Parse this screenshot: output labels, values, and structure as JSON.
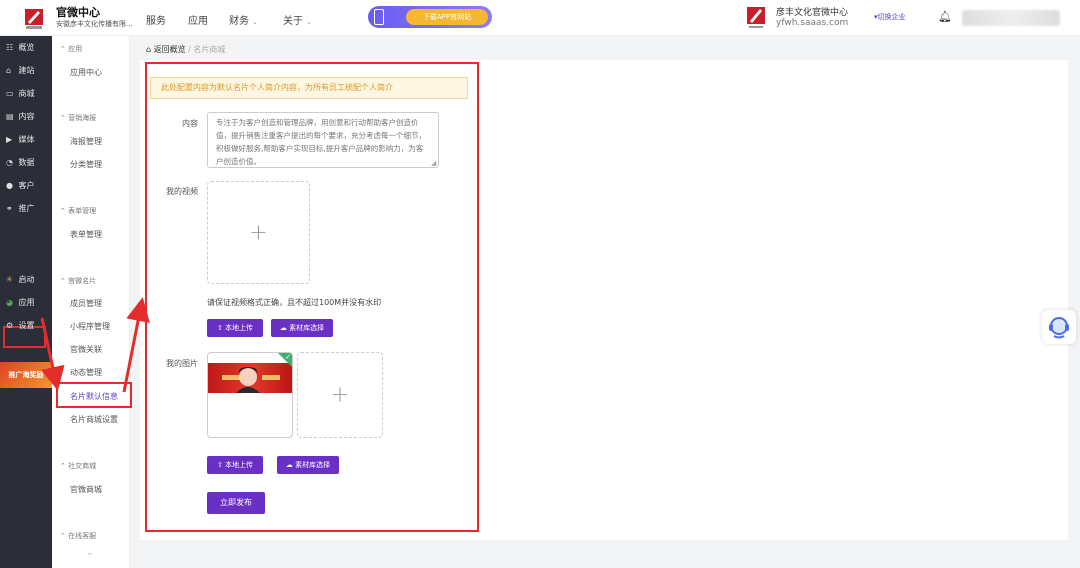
{
  "header": {
    "brand_title": "官微中心",
    "brand_sub": "安徽彦丰文化传播有限...",
    "nav": [
      {
        "label": "服务",
        "caret": false
      },
      {
        "label": "应用",
        "caret": false
      },
      {
        "label": "财务",
        "caret": true
      },
      {
        "label": "关于",
        "caret": true
      }
    ],
    "download_label": "下载APP官网站",
    "company_name": "彦丰文化官微中心",
    "company_url": "yfwh.saaas.com",
    "switch_label": "切换企业"
  },
  "sidebar": {
    "items": [
      {
        "icon": "overview-icon",
        "glyph": "☷",
        "label": "概览"
      },
      {
        "icon": "home-icon",
        "glyph": "⌂",
        "label": "建站"
      },
      {
        "icon": "shop-icon",
        "glyph": "▭",
        "label": "商城"
      },
      {
        "icon": "content-icon",
        "glyph": "▤",
        "label": "内容"
      },
      {
        "icon": "media-icon",
        "glyph": "▶",
        "label": "媒体"
      },
      {
        "icon": "data-icon",
        "glyph": "◔",
        "label": "数据"
      },
      {
        "icon": "customer-icon",
        "glyph": "●",
        "label": "客户"
      },
      {
        "icon": "promote-icon",
        "glyph": "⚭",
        "label": "推广"
      }
    ],
    "launch": "启动",
    "app": "应用",
    "settings": "设置",
    "promo": "推广海奖励"
  },
  "subnav": {
    "groups": [
      {
        "head": "应用",
        "items": [
          "应用中心"
        ]
      },
      {
        "head": "营销海报",
        "items": [
          "海报管理",
          "分类管理"
        ]
      },
      {
        "head": "表单管理",
        "items": [
          "表单管理"
        ]
      },
      {
        "head": "官微名片",
        "items": [
          "成员管理",
          "小程序管理",
          "官微关联",
          "动态管理",
          "名片默认信息",
          "名片商城设置"
        ]
      },
      {
        "head": "社交商城",
        "items": [
          "官微商城"
        ]
      },
      {
        "head": "在线客服",
        "items": []
      }
    ],
    "active": "名片默认信息"
  },
  "breadcrumb": {
    "home": "返回概览",
    "sep": "/",
    "current": "名片商城"
  },
  "form": {
    "notice": "此处配置内容为默认名片个人简介内容，为所有员工统配个人简介",
    "content_label": "内容",
    "content_text": "专注于为客户创造和管理品牌，用创意和行动帮助客户创造价值，提升销售注重客户提出的每个要求，充分考虑每一个细节，积极做好服务,帮助客户实现目标,提升客户品牌的影响力，为客户创造价值。",
    "video_label": "我的视频",
    "video_hint": "请保证视频格式正确，且不超过100M并没有水印",
    "upload_local": "本地上传",
    "upload_library": "素材库选择",
    "image_label": "我的图片",
    "publish": "立即发布"
  }
}
